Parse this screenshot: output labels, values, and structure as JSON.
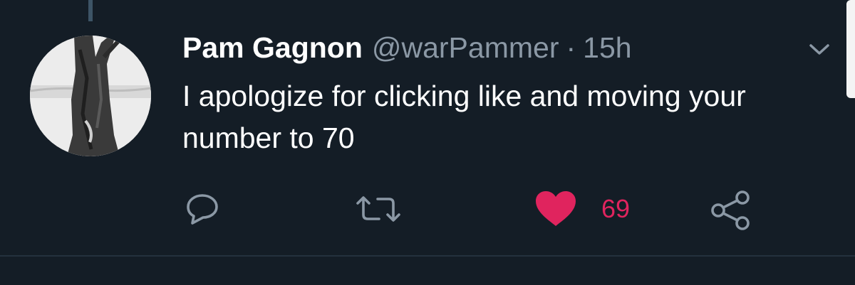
{
  "tweet": {
    "author": {
      "display_name": "Pam Gagnon",
      "handle": "@warPammer"
    },
    "separator": "·",
    "timestamp": "15h",
    "text": "I apologize for clicking like and moving your number to 70",
    "actions": {
      "reply_icon": "speech-bubble-icon",
      "retweet_icon": "retweet-arrows-icon",
      "like_icon": "heart-filled-icon",
      "like_count": "69",
      "share_icon": "share-nodes-icon"
    },
    "menu_icon": "chevron-down-icon"
  },
  "colors": {
    "background": "#141d26",
    "primary_text": "#ffffff",
    "secondary_text": "#8b98a5",
    "icon": "#8b98a5",
    "like": "#e0245e",
    "divider": "#24313d"
  }
}
